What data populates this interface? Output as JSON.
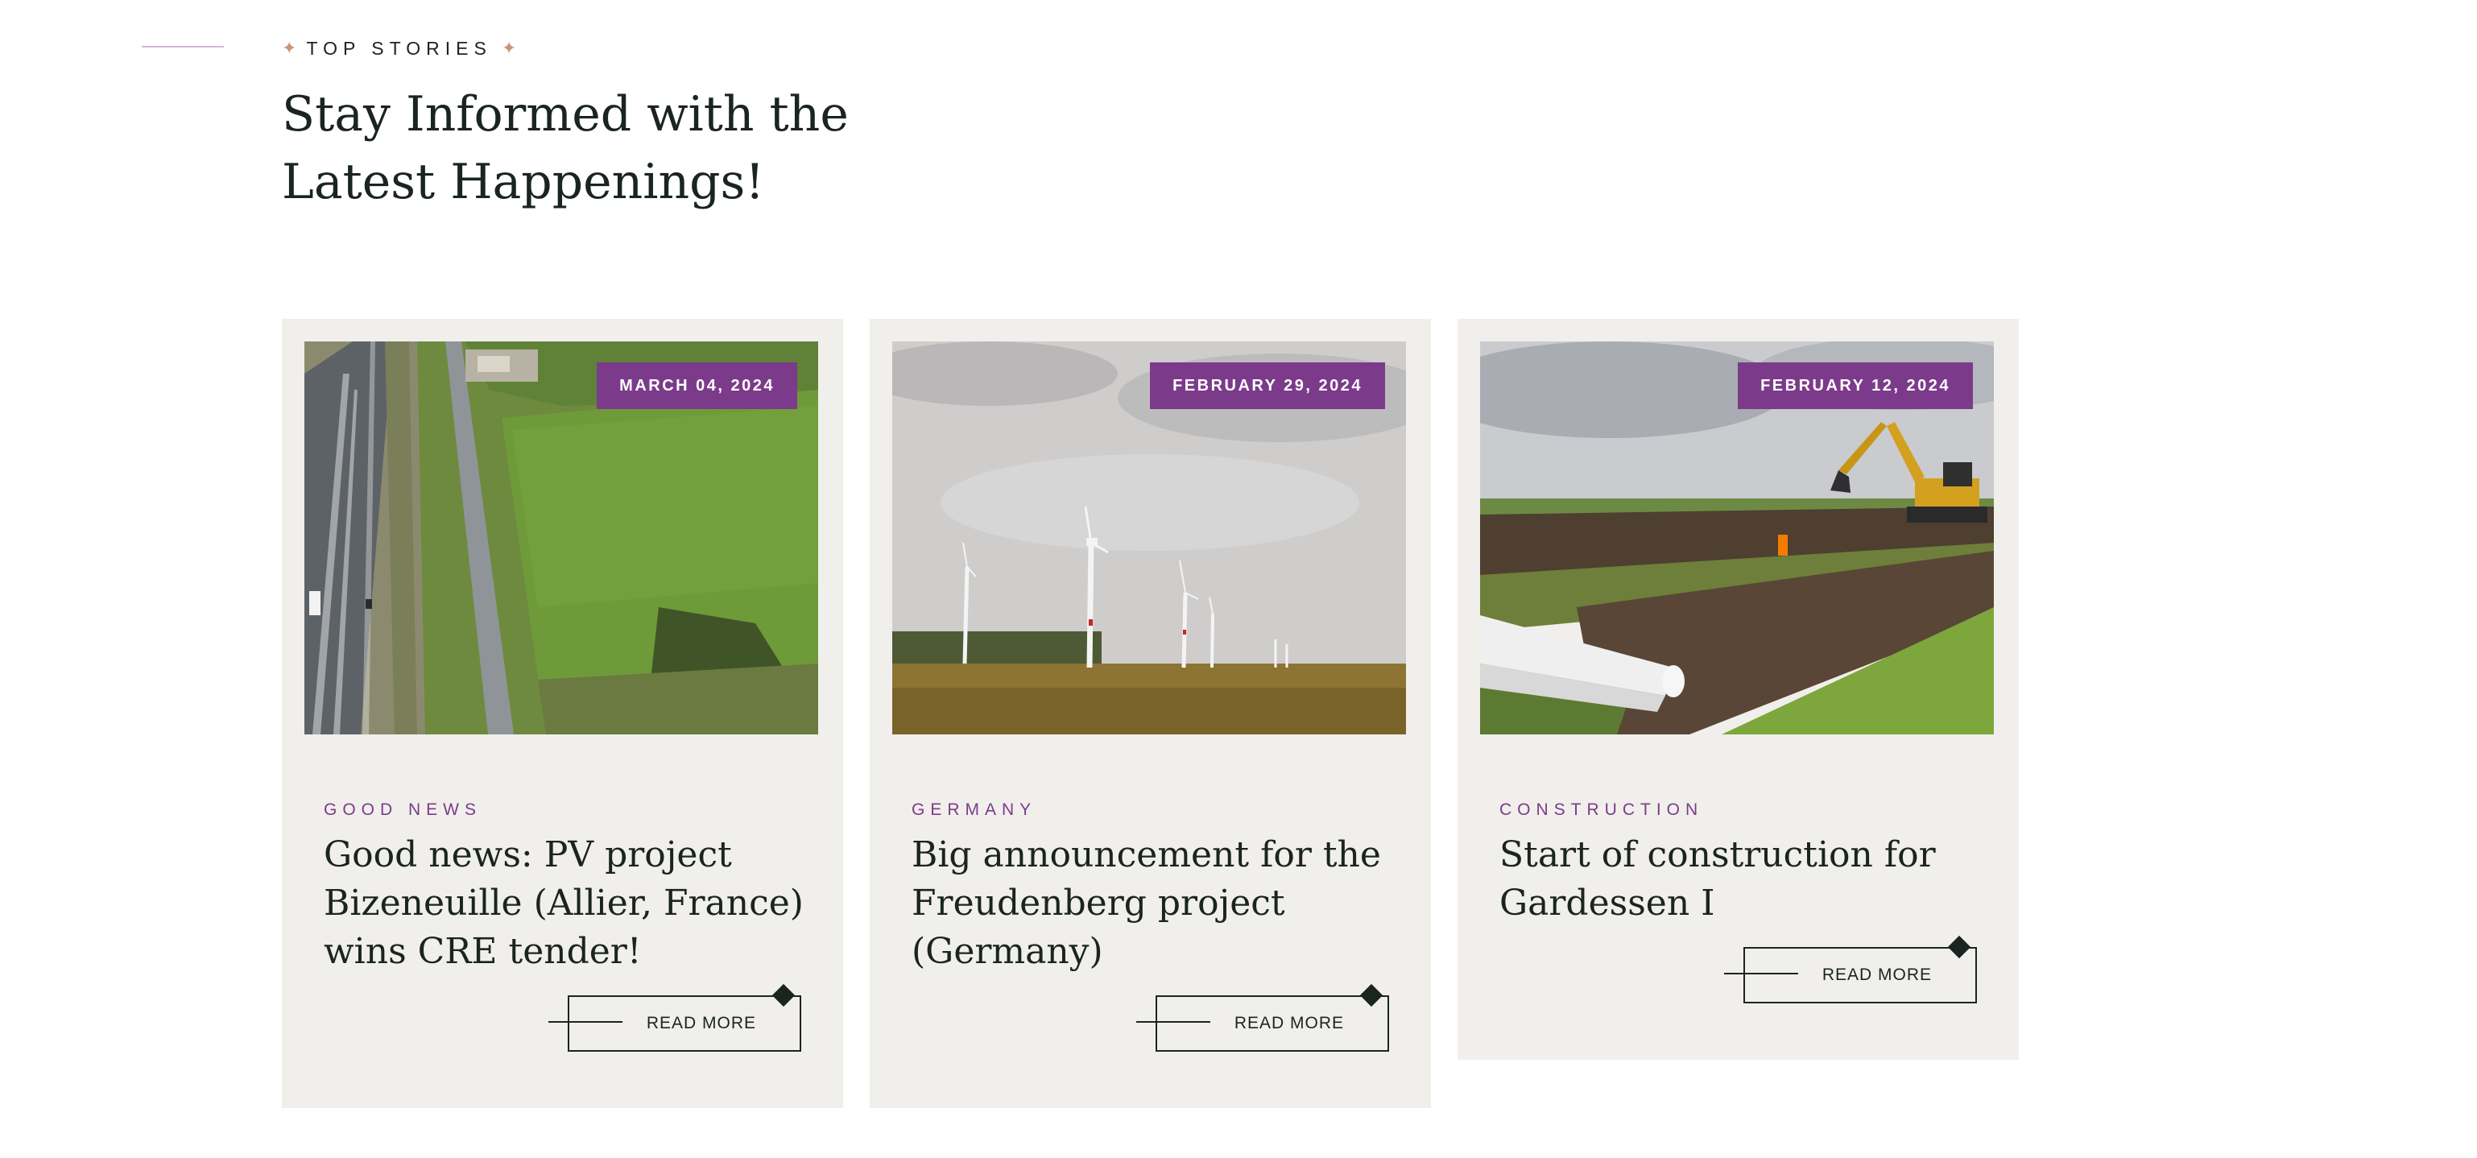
{
  "header": {
    "eyebrow_label": "TOP STORIES",
    "star_glyph": "✦",
    "title_line1": "Stay Informed with the",
    "title_line2": "Latest Happenings!"
  },
  "cards": [
    {
      "date": "MARCH 04, 2024",
      "category": "GOOD NEWS",
      "title": "Good news: PV project Bizeneuille (Allier, France) wins CRE tender!",
      "cta": "READ MORE",
      "image": "aerial-highway-field-photo"
    },
    {
      "date": "FEBRUARY 29, 2024",
      "category": "GERMANY",
      "title": "Big announcement for the Freudenberg project (Germany)",
      "cta": "READ MORE",
      "image": "wind-turbines-field-photo"
    },
    {
      "date": "FEBRUARY 12, 2024",
      "category": "CONSTRUCTION",
      "title": "Start of construction for Gardessen I",
      "cta": "READ MORE",
      "image": "excavator-construction-site-photo"
    }
  ],
  "colors": {
    "accent_purple": "#7b3b8a",
    "text_dark": "#1a2421",
    "card_bg": "#f1efeb",
    "star_gold": "#c9957a",
    "deco_line": "#d6b6d6"
  }
}
